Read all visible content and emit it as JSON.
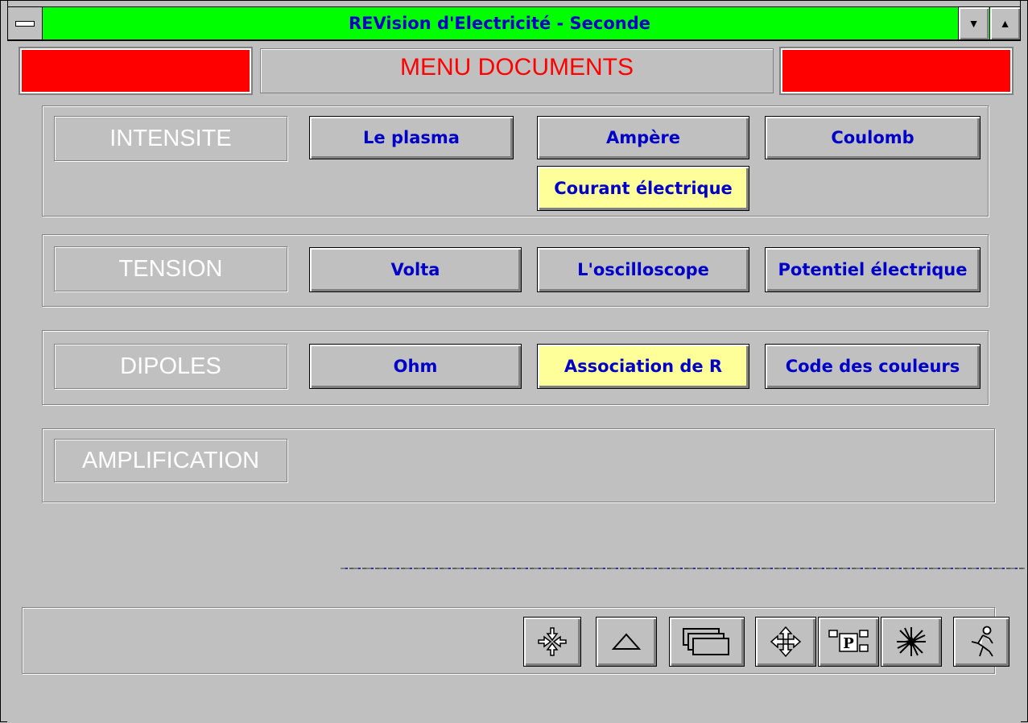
{
  "window": {
    "title": "REVision d'Electricité - Seconde"
  },
  "header": {
    "title": "MENU DOCUMENTS",
    "title_color": "#ff0000",
    "side_box_color": "#ff0000"
  },
  "groups": [
    {
      "label": "INTENSITE",
      "buttons": [
        "Le plasma",
        "Ampère",
        "Coulomb",
        "Courant électrique"
      ],
      "highlighted": "Courant électrique"
    },
    {
      "label": "TENSION",
      "buttons": [
        "Volta",
        "L'oscilloscope",
        "Potentiel électrique"
      ]
    },
    {
      "label": "DIPOLES",
      "buttons": [
        "Ohm",
        "Association de R",
        "Code des couleurs"
      ],
      "highlighted": "Association de R"
    },
    {
      "label": "AMPLIFICATION",
      "buttons": []
    }
  ],
  "toolbar": {
    "icons": [
      "compress-icon",
      "triangle-up-icon",
      "windows-icon",
      "move-arrows-icon",
      "print-layout-icon",
      "star-burst-icon",
      "exit-running-man-icon"
    ]
  },
  "colors": {
    "titlebar": "#00ff00",
    "button_text": "#0000c8",
    "highlight_button": "#ffff99",
    "background": "#c0c0c0"
  }
}
